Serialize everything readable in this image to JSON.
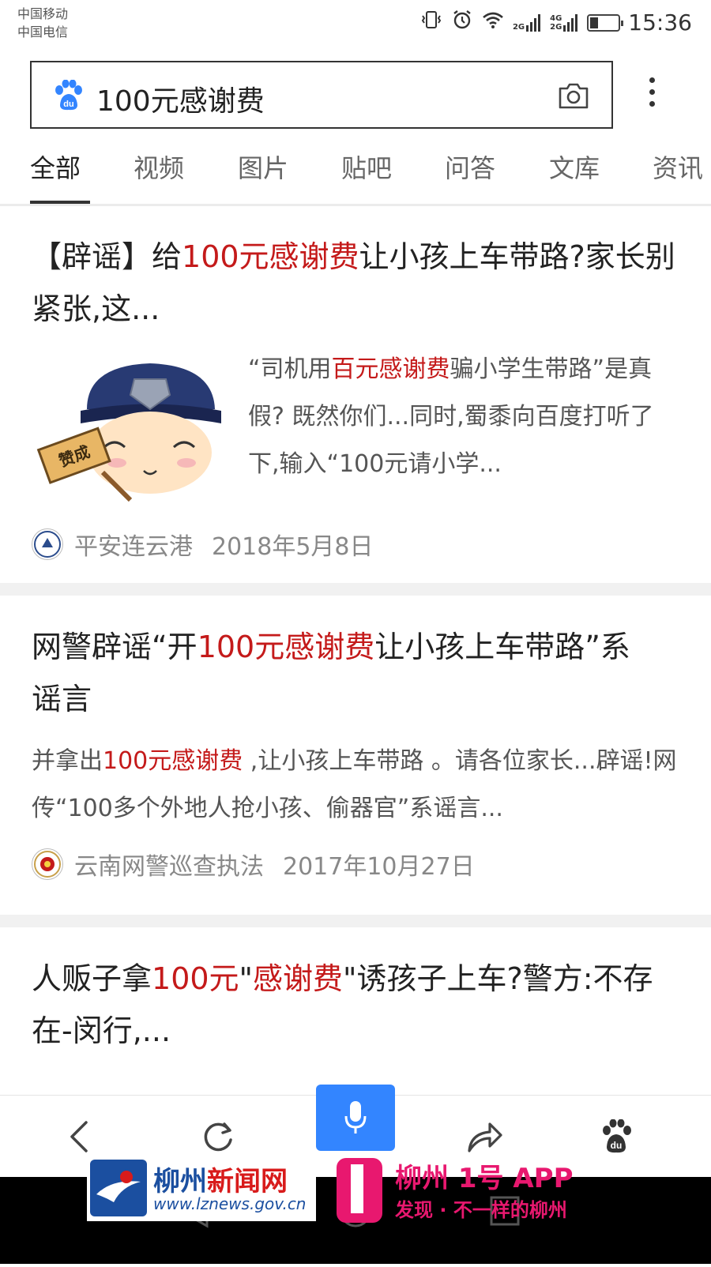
{
  "status_bar": {
    "carrier_1": "中国移动",
    "carrier_2": "中国电信",
    "net_1": "2G",
    "net_2_top": "4G",
    "net_2_bottom": "2G",
    "battery_level": 0.3,
    "time": "15:36",
    "icons": [
      "vibrate-icon",
      "alarm-icon",
      "wifi-icon",
      "signal-icon",
      "signal-icon",
      "battery-icon"
    ]
  },
  "search": {
    "query": "100元感谢费",
    "brand_icon": "baidu-paw-icon",
    "camera_icon": "camera-icon",
    "more_icon": "more-vertical-icon"
  },
  "tabs": [
    "全部",
    "视频",
    "图片",
    "贴吧",
    "问答",
    "文库",
    "资讯"
  ],
  "active_tab": "全部",
  "results": [
    {
      "title_parts": [
        "【辟谣】给",
        "100元感谢费",
        "让小孩上车带路?家长别紧张,这..."
      ],
      "snippet_parts": [
        "“司机用",
        "百元感谢费",
        "骗小学生带路”是真假? 既然你们...同时,蜀黍向百度打听了下,输入“100元请小学..."
      ],
      "thumbnail_sign_text": "赞成",
      "source": "平安连云港",
      "date": "2018年5月8日"
    },
    {
      "title_parts": [
        "网警辟谣“开",
        "100元感谢费",
        "让小孩上车带路”系谣言"
      ],
      "snippet_parts": [
        "并拿出",
        "100元感谢费",
        " ,让小孩上车带路 。请各位家长...辟谣!网传“100多个外地人抢小孩、偷器官”系谣言..."
      ],
      "source": "云南网警巡查执法",
      "date": "2017年10月27日"
    },
    {
      "title_parts": [
        "人贩子拿",
        "100元",
        "\"",
        "感谢费",
        "\"诱孩子上车?警方:不存在-闵行,..."
      ]
    }
  ],
  "bottom_nav": [
    "back-icon",
    "refresh-icon",
    "microphone-icon",
    "share-icon",
    "baidu-paw-icon"
  ],
  "banner": {
    "site_name_1": "柳州",
    "site_name_2": "新闻网",
    "site_url": "www.lznews.gov.cn",
    "app_name": "柳州 1号 APP",
    "app_slogan": "发现 · 不一样的柳州"
  },
  "colors": {
    "highlight": "#c41a1a",
    "accent_blue": "#3385ff",
    "banner_blue": "#1b4fa0",
    "banner_pink": "#e8186f"
  }
}
